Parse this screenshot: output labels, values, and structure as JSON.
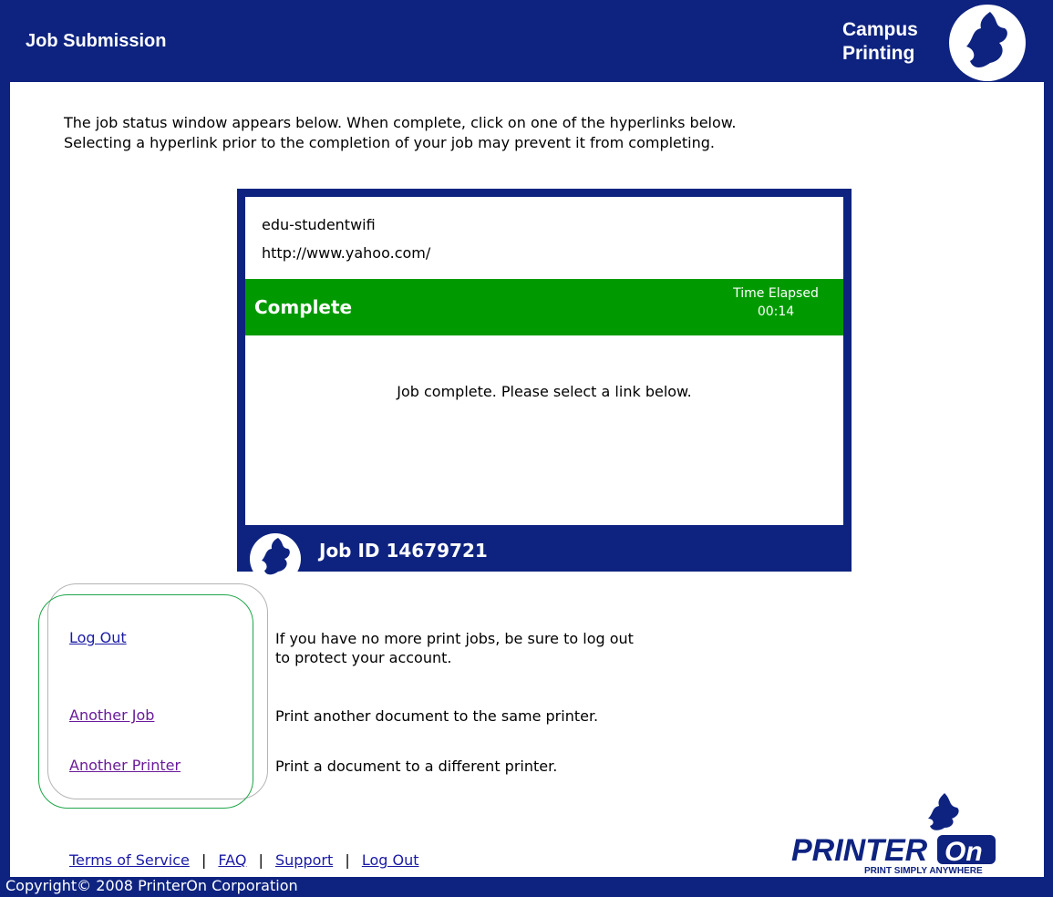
{
  "header": {
    "title": "Job Submission",
    "brand_line1": "Campus",
    "brand_line2": "Printing"
  },
  "intro": {
    "line1": "The job status window appears below. When complete, click on one of the hyperlinks below.",
    "line2": "Selecting a hyperlink prior to the completion of your job may prevent it from completing."
  },
  "job_status": {
    "network": "edu-studentwifi",
    "url": "http://www.yahoo.com/",
    "status": "Complete",
    "elapsed_label": "Time Elapsed",
    "elapsed_value": "00:14",
    "message": "Job complete. Please select a link below.",
    "job_id": "Job ID 14679721"
  },
  "links": [
    {
      "label": "Log Out",
      "description": "If you have no more print jobs, be sure to log out to protect your account."
    },
    {
      "label": "Another Job",
      "description": "Print another document to the same printer."
    },
    {
      "label": "Another Printer",
      "description": "Print a document to a different printer."
    }
  ],
  "footer": {
    "terms": "Terms of Service",
    "faq": "FAQ",
    "support": "Support",
    "logout": "Log Out",
    "separator": "|",
    "copyright": "Copyright© 2008 PrinterOn Corporation"
  },
  "printeron_logo": {
    "name": "PRINTERON",
    "tagline": "PRINT SIMPLY ANYWHERE"
  },
  "colors": {
    "navy": "#0e2380",
    "green": "#009a00",
    "link": "#1a1aa6",
    "visited_link": "#6a1a9a"
  }
}
